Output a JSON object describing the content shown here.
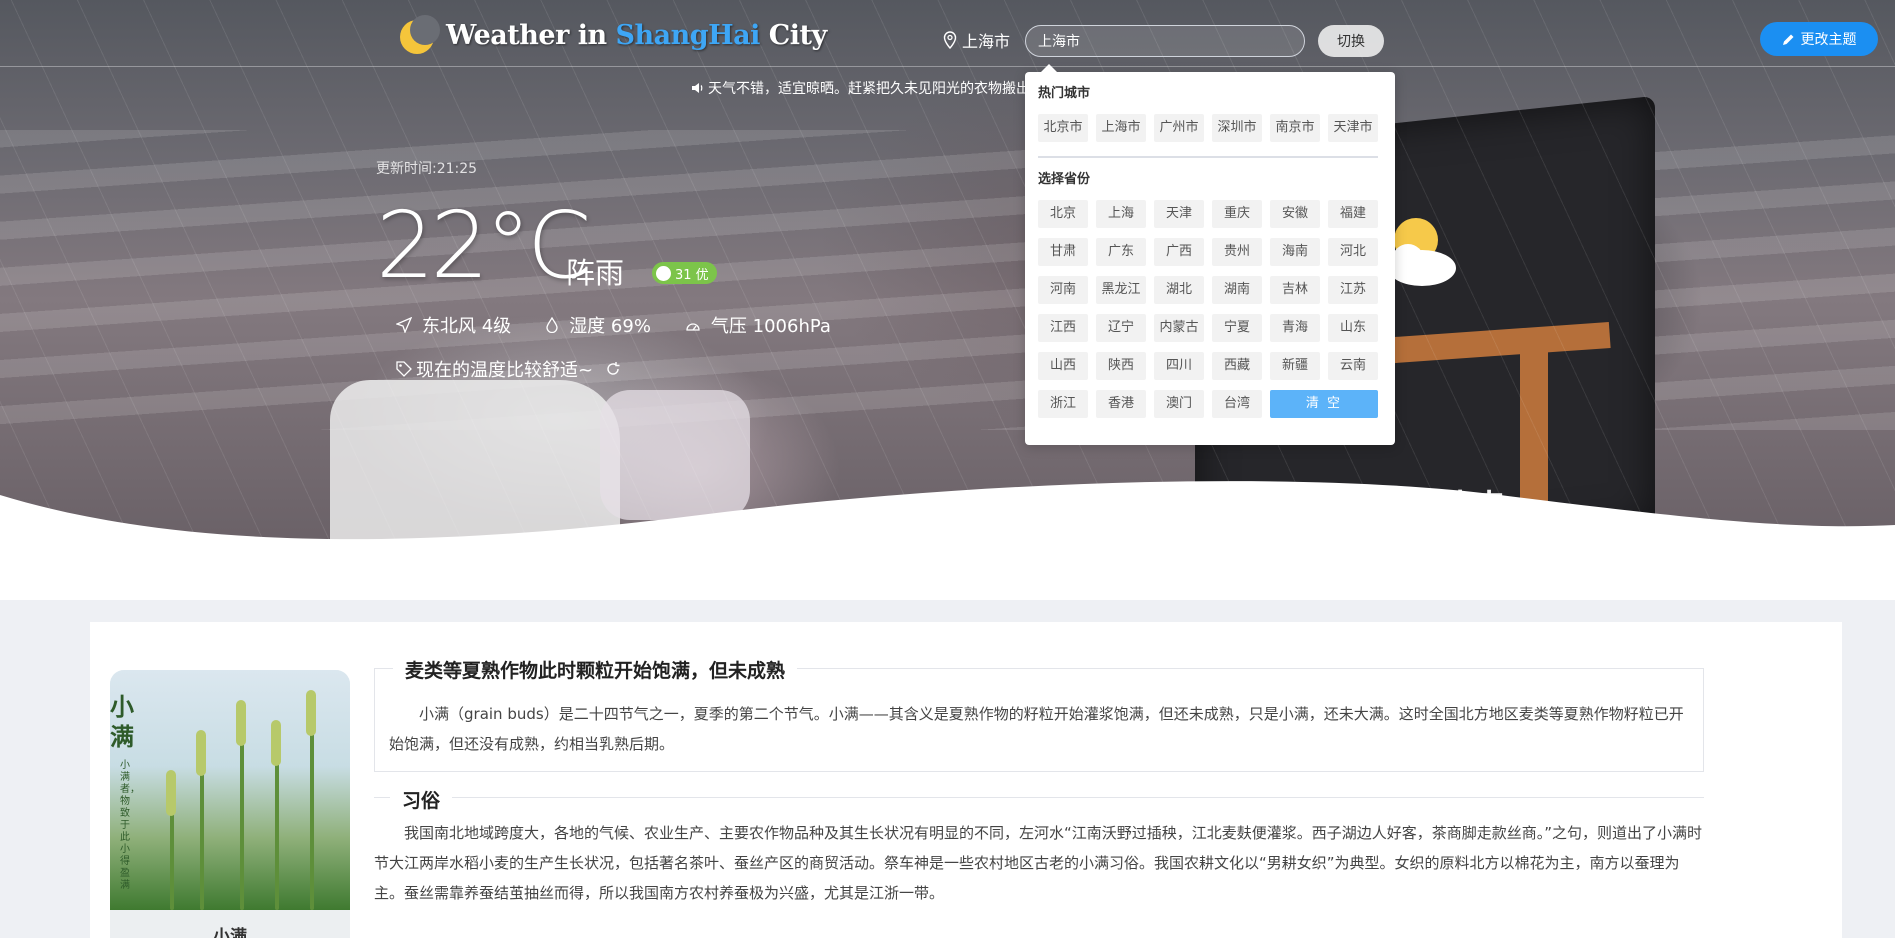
{
  "brand": {
    "prefix": "Weather in ",
    "city": "ShangHai",
    "suffix": " City"
  },
  "header": {
    "location_label": "上海市",
    "city_input_value": "上海市",
    "switch_label": "切换",
    "theme_label": "更改主题"
  },
  "notice": "天气不错，适宜晾晒。赶紧把久未见阳光的衣物搬出",
  "current": {
    "update_time": "更新时间:21:25",
    "temperature": "22°C",
    "condition": "阵雨",
    "aqi": "31 优",
    "wind": "东北风 4级",
    "humidity": "湿度 69%",
    "pressure": "气压 1006hPa",
    "tip": "现在的温度比较舒适~"
  },
  "dropdown": {
    "hot_title": "热门城市",
    "hot_cities": [
      "北京市",
      "上海市",
      "广州市",
      "深圳市",
      "南京市",
      "天津市"
    ],
    "province_title": "选择省份",
    "provinces": [
      "北京",
      "上海",
      "天津",
      "重庆",
      "安徽",
      "福建",
      "甘肃",
      "广东",
      "广西",
      "贵州",
      "海南",
      "河北",
      "河南",
      "黑龙江",
      "湖北",
      "湖南",
      "吉林",
      "江苏",
      "江西",
      "辽宁",
      "内蒙古",
      "宁夏",
      "青海",
      "山东",
      "山西",
      "陕西",
      "四川",
      "西藏",
      "新疆",
      "云南",
      "浙江",
      "香港",
      "澳门",
      "台湾"
    ],
    "clear_label": "清 空"
  },
  "hero_art": {
    "bag_brand": "美团外卖"
  },
  "solar_term": {
    "card_label": "小满",
    "card_vertical_title": "小满",
    "card_vertical_sub": "小满者，物致于此小得盈满",
    "section1_title": "麦类等夏熟作物此时颗粒开始饱满，但未成熟",
    "section1_body": "小满（grain buds）是二十四节气之一，夏季的第二个节气。小满——其含义是夏熟作物的籽粒开始灌浆饱满，但还未成熟，只是小满，还未大满。这时全国北方地区麦类等夏熟作物籽粒已开始饱满，但还没有成熟，约相当乳熟后期。",
    "section2_title": "习俗",
    "section2_body": "我国南北地域跨度大，各地的气候、农业生产、主要农作物品种及其生长状况有明显的不同，左河水“江南沃野过插秧，江北麦麸便灌浆。西子湖边人好客，茶商脚走款丝商。”之句，则道出了小满时节大江两岸水稻小麦的生产生长状况，包括著名茶叶、蚕丝产区的商贸活动。祭车神是一些农村地区古老的小满习俗。我国农耕文化以“男耕女织”为典型。女织的原料北方以棉花为主，南方以蚕理为主。蚕丝需靠养蚕结茧抽丝而得，所以我国南方农村养蚕极为兴盛，尤其是江浙一带。"
  },
  "icons": {
    "logo": "moon-icon",
    "location": "map-pin-icon",
    "theme": "pencil-icon",
    "notice": "speaker-icon",
    "wind": "send-icon",
    "humidity": "droplet-icon",
    "pressure": "gauge-icon",
    "tip": "tag-icon",
    "refresh": "refresh-icon",
    "weather": "sun-cloud-icon"
  },
  "colors": {
    "accent": "#1b8ff2",
    "brand_city": "#3ea6f5",
    "aqi_good": "#7cc44a",
    "clear_button": "#5cb3f9"
  }
}
